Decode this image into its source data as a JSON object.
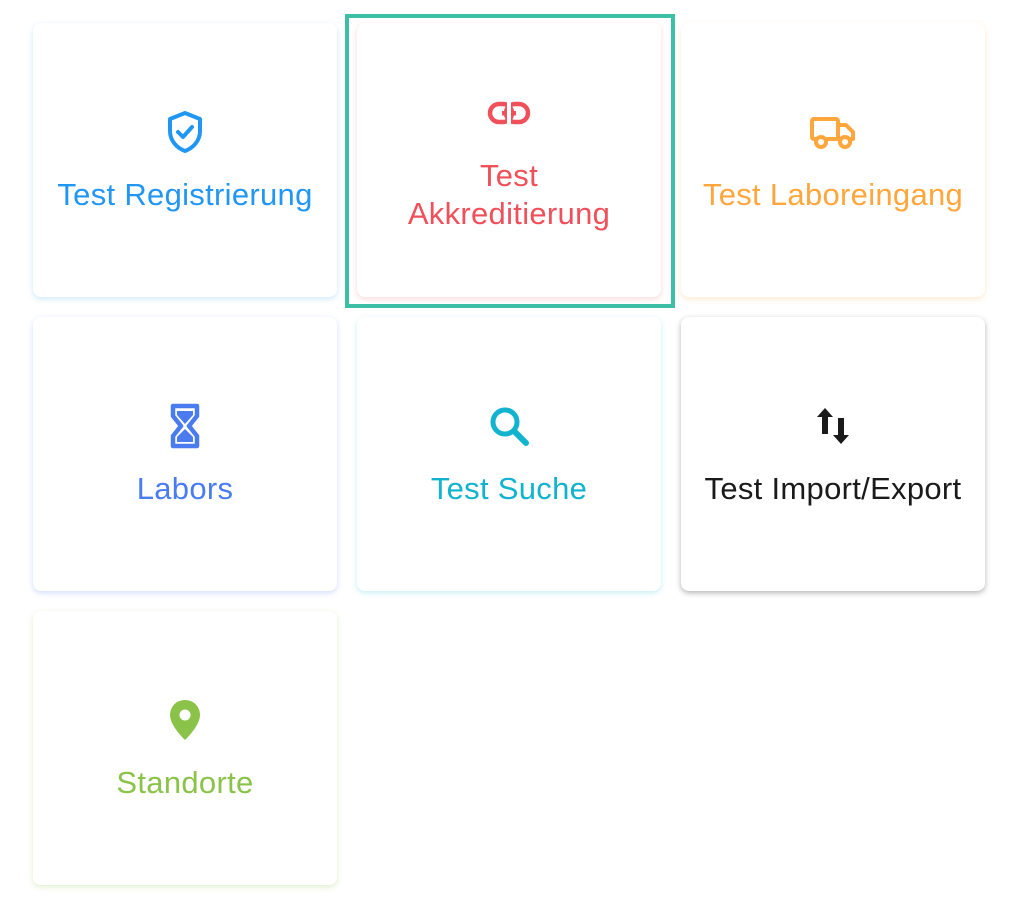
{
  "tiles": [
    {
      "id": "test-registrierung",
      "label": "Test Registrierung",
      "icon": "shield-check-icon",
      "color": "#2196f3"
    },
    {
      "id": "test-akkreditierung",
      "label": "Test\nAkkreditierung",
      "icon": "link-icon",
      "color": "#f0505a",
      "selected": true
    },
    {
      "id": "test-laboreingang",
      "label": "Test Laboreingang",
      "icon": "truck-icon",
      "color": "#ffa63c"
    },
    {
      "id": "labors",
      "label": "Labors",
      "icon": "hourglass-icon",
      "color": "#4a7cf0"
    },
    {
      "id": "test-suche",
      "label": "Test Suche",
      "icon": "search-icon",
      "color": "#12b3cf"
    },
    {
      "id": "test-import-export",
      "label": "Test Import/Export",
      "icon": "swap-vertical-icon",
      "color": "#1a1a1a"
    },
    {
      "id": "standorte",
      "label": "Standorte",
      "icon": "map-pin-icon",
      "color": "#8bc34a"
    }
  ],
  "selection_color": "#3dbfa5"
}
